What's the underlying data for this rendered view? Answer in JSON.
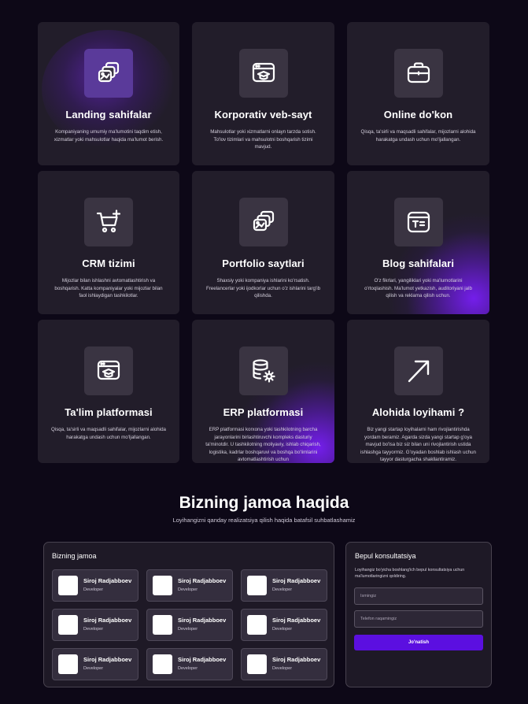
{
  "services": [
    {
      "title": "Landing sahifalar",
      "icon": "layers-image-icon",
      "glow": "center",
      "desc": "Kompaniyaning umumiy ma'lumotini taqdim etish, xizmatlar yoki mahsulotlar haqida ma'lumot berish."
    },
    {
      "title": "Korporativ veb-sayt",
      "icon": "browser-graduation-icon",
      "glow": "none",
      "desc": "Mahsulotlar yoki xizmatlarni onlayn tarzda sotish. To'lov tizimlari va mahsulotni boshqarish tizimi mavjud."
    },
    {
      "title": "Online do'kon",
      "icon": "briefcase-icon",
      "glow": "none",
      "desc": "Qisqa, ta'sirli va maqsadli sahifalar, mijozlarni alohida harakatga undash uchun mo'ljallangan."
    },
    {
      "title": "CRM tizimi",
      "icon": "cart-plus-icon",
      "glow": "none",
      "desc": "Mijozlar bilan ishlashni avtomatlashtirish va boshqarish. Katta kompaniyalar yoki mijozlar bilan faol ishlaydigan tashkilotlar."
    },
    {
      "title": "Portfolio saytlari",
      "icon": "layers-image-icon",
      "glow": "none",
      "desc": "Shaxsiy yoki kompaniya ishlarini ko'rsatish. Freelancerlar yoki ijodkorlar uchun o'z ishlarini targ'ib qilishda."
    },
    {
      "title": "Blog sahifalari",
      "icon": "text-card-icon",
      "glow": "br",
      "desc": "O'z fikrlari, yangiliklari yoki ma'lumotlarini o'rtoqlashish. Ma'lumot yetkazish, auditoriyani jalb qilish va reklama qilish uchun."
    },
    {
      "title": "Ta'lim platformasi",
      "icon": "browser-graduation-icon",
      "glow": "none",
      "desc": "Qisqa, ta'sirli va maqsadli sahifalar, mijozlarni alohida harakatga undash uchun mo'ljallangan."
    },
    {
      "title": "ERP platformasi",
      "icon": "database-gear-icon",
      "glow": "br",
      "desc": "ERP platformasi korxona yoki tashkilotning barcha jarayonlarini birlashtiruvchi kompleks dasturiy ta'minotdir. U tashkilotning moliyaviy, ishlab chiqarish, logistika, kadrlar boshqaruvi va boshqa bo'limlarini avtomatlashtirish uchun"
    },
    {
      "title": "Alohida loyihami ?",
      "icon": "arrow-up-right-icon",
      "glow": "none",
      "desc": "Biz yangi startap loyihalarni ham rivojlantirishda yordam beramiz. Agarda sizda yangi startap g'oya mavjud bo'lsa biz siz bilan uni rivojlantirish ustida ishlashga tayyormiz. G'oyadan boshlab ishlash uchun tayyor dasturgacha shakllantiramiz."
    }
  ],
  "team_section": {
    "title": "Bizning jamoa haqida",
    "subtitle": "Loyihangizni qanday realizatsiya qilish haqida batafsil suhbatlashamiz"
  },
  "team_panel": {
    "title": "Bizning jamoa",
    "members": [
      {
        "name": "Siroj Radjabboev",
        "role": "Developer"
      },
      {
        "name": "Siroj Radjabboev",
        "role": "Developer"
      },
      {
        "name": "Siroj Radjabboev",
        "role": "Developer"
      },
      {
        "name": "Siroj Radjabboev",
        "role": "Developer"
      },
      {
        "name": "Siroj Radjabboev",
        "role": "Developer"
      },
      {
        "name": "Siroj Radjabboev",
        "role": "Developer"
      },
      {
        "name": "Siroj Radjabboev",
        "role": "Developer"
      },
      {
        "name": "Siroj Radjabboev",
        "role": "Developer"
      },
      {
        "name": "Siroj Radjabboev",
        "role": "Developer"
      }
    ]
  },
  "consult": {
    "title": "Bepul konsultatsiya",
    "text": "Loyihangiz bo'yicha boshlang'ich bepul konsultatsiya uchun ma'lumotlaringizni qoldiring.",
    "name_placeholder": "Ismingiz",
    "phone_placeholder": "Telefon raqamingiz",
    "submit_label": "Jo'natish"
  },
  "colors": {
    "background": "#0d0817",
    "card": "#221d2a",
    "accent": "#5b0fe0"
  }
}
